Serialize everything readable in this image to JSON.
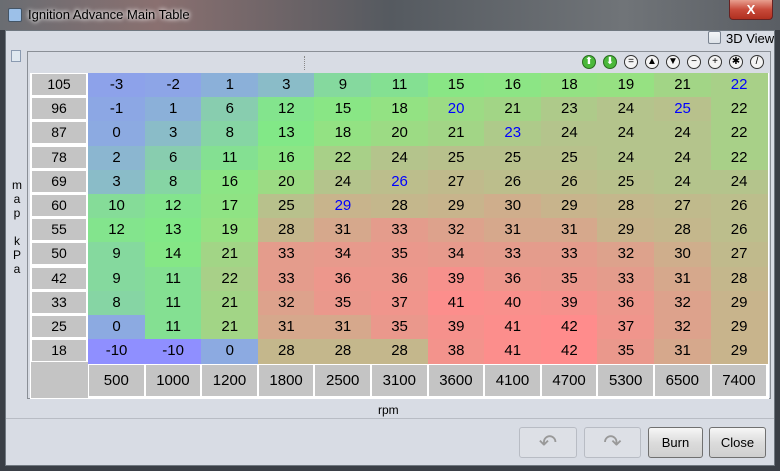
{
  "window": {
    "title": "Ignition Advance Main Table",
    "close_label": "X"
  },
  "view3d": {
    "label": "3D View",
    "checked": false
  },
  "toolbar": [
    {
      "icon": "arrow-up-green-icon",
      "glyph": "⬆"
    },
    {
      "icon": "arrow-down-green-icon",
      "glyph": "⬇"
    },
    {
      "icon": "equals-icon",
      "glyph": "="
    },
    {
      "icon": "increase-icon",
      "glyph": "▲"
    },
    {
      "icon": "decrease-icon",
      "glyph": "▼"
    },
    {
      "icon": "minus-icon",
      "glyph": "−"
    },
    {
      "icon": "plus-icon",
      "glyph": "+"
    },
    {
      "icon": "multiply-icon",
      "glyph": "✱"
    },
    {
      "icon": "color-icon",
      "glyph": "/"
    }
  ],
  "y_axis": {
    "label": "map kPa",
    "values": [
      "105",
      "96",
      "87",
      "78",
      "69",
      "60",
      "55",
      "50",
      "42",
      "33",
      "25",
      "18"
    ]
  },
  "x_axis": {
    "label": "rpm",
    "values": [
      "500",
      "1000",
      "1200",
      "1800",
      "2500",
      "3100",
      "3600",
      "4100",
      "4700",
      "5300",
      "6500",
      "7400"
    ]
  },
  "table": [
    [
      -3,
      -2,
      1,
      3,
      9,
      11,
      15,
      16,
      18,
      19,
      21,
      22
    ],
    [
      -1,
      1,
      6,
      12,
      15,
      18,
      20,
      21,
      23,
      24,
      25,
      22
    ],
    [
      0,
      3,
      8,
      13,
      18,
      20,
      21,
      23,
      24,
      24,
      24,
      22
    ],
    [
      2,
      6,
      11,
      16,
      22,
      24,
      25,
      25,
      25,
      24,
      24,
      22
    ],
    [
      3,
      8,
      16,
      20,
      24,
      26,
      27,
      26,
      26,
      25,
      24,
      24
    ],
    [
      10,
      12,
      17,
      25,
      29,
      28,
      29,
      30,
      29,
      28,
      27,
      26
    ],
    [
      12,
      13,
      19,
      28,
      31,
      33,
      32,
      31,
      31,
      29,
      28,
      26
    ],
    [
      9,
      14,
      21,
      33,
      34,
      35,
      34,
      33,
      33,
      32,
      30,
      27
    ],
    [
      9,
      11,
      22,
      33,
      36,
      36,
      39,
      36,
      35,
      33,
      31,
      28
    ],
    [
      8,
      11,
      21,
      32,
      35,
      37,
      41,
      40,
      39,
      36,
      32,
      29
    ],
    [
      0,
      11,
      21,
      31,
      31,
      35,
      39,
      41,
      42,
      37,
      32,
      29
    ],
    [
      -10,
      -10,
      0,
      28,
      28,
      28,
      38,
      41,
      42,
      35,
      31,
      29
    ]
  ],
  "highlighted_cells": [
    [
      0,
      11
    ],
    [
      1,
      6
    ],
    [
      1,
      10
    ],
    [
      2,
      7
    ],
    [
      4,
      5
    ],
    [
      5,
      4
    ]
  ],
  "highlight_text_color": "#0000ff",
  "buttons": {
    "undo": "↶",
    "redo": "↷",
    "burn": "Burn",
    "close": "Close"
  }
}
